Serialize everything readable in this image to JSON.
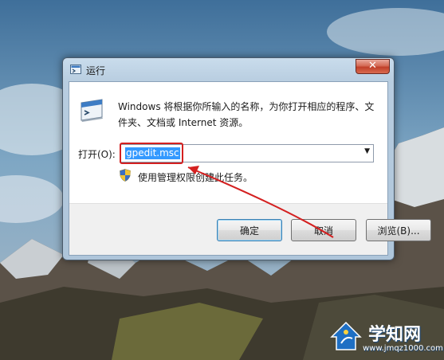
{
  "dialog": {
    "title": "运行",
    "close_label": "✕",
    "description": "Windows 将根据你所输入的名称，为你打开相应的程序、文件夹、文档或 Internet 资源。",
    "open_label": "打开(O):",
    "open_value": "gpedit.msc",
    "dropdown_arrow": "▼",
    "admin_note": "使用管理权限创建此任务。",
    "buttons": {
      "ok": "确定",
      "cancel": "取消",
      "browse": "浏览(B)..."
    }
  },
  "watermark": {
    "title": "学知网",
    "url": "www.jmqz1000.com"
  },
  "icons": {
    "title": "run-icon",
    "body": "run-dialog-icon",
    "admin": "uac-shield-icon",
    "close": "close-icon",
    "watermark": "watermark-logo-icon"
  },
  "colors": {
    "highlight": "#d42020",
    "selection": "#3399ff",
    "close_button": "#c0402a"
  }
}
